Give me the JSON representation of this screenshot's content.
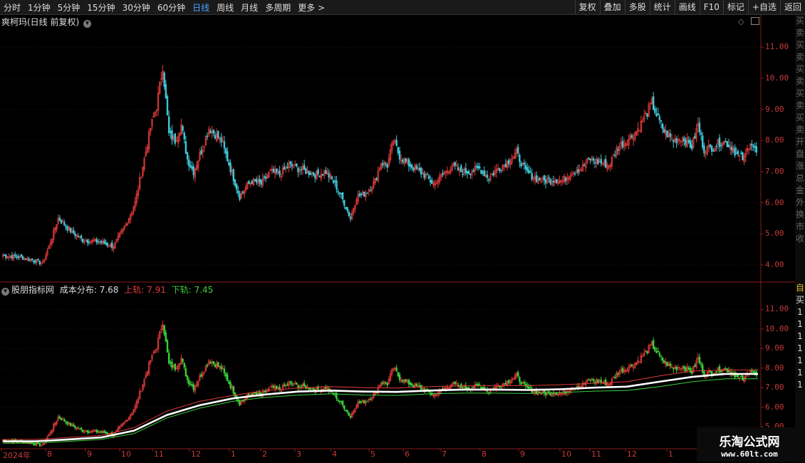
{
  "toolbar": {
    "periods": [
      "分时",
      "1分钟",
      "5分钟",
      "15分钟",
      "30分钟",
      "60分钟",
      "日线",
      "周线",
      "月线",
      "多周期",
      "更多 >"
    ],
    "active_period": "日线",
    "actions": [
      "复权",
      "叠加",
      "多股",
      "统计",
      "画线",
      "F10",
      "标记",
      "+自选",
      "返回"
    ]
  },
  "main_panel": {
    "title": "爽柯玛(日线 前复权)",
    "icons": [
      "chevron-down-icon",
      "diamond-icon",
      "panel-toggle-icon"
    ]
  },
  "indicator_panel": {
    "name": "股朋指标网",
    "cost_label": "成本分布:",
    "cost_value": "7.68",
    "upper_label": "上轨:",
    "upper_value": "7.91",
    "lower_label": "下轨:",
    "lower_value": "7.45",
    "colors": {
      "cost": "#ffffff",
      "upper": "#e03a3a",
      "lower": "#3ad13a"
    }
  },
  "main_axis_ticks": [
    "11.00",
    "10.00",
    "9.00",
    "8.00",
    "7.00",
    "6.00",
    "5.00",
    "4.00"
  ],
  "indicator_axis_ticks": [
    "11.00",
    "10.00",
    "9.00",
    "8.00",
    "7.00",
    "6.00",
    "5.00"
  ],
  "x_axis_labels": [
    "2024年",
    "8",
    "9",
    "10",
    "11",
    "12",
    "1",
    "2",
    "3",
    "4",
    "5",
    "6",
    "7",
    "8",
    "9",
    "10",
    "11",
    "12",
    "1"
  ],
  "sidebar_text": [
    "买",
    "卖",
    "买",
    "卖",
    "买",
    "卖",
    "买",
    "卖",
    "买",
    "卖",
    "开",
    "盘",
    "涨",
    "总",
    "金",
    "外",
    "换",
    "市",
    "收"
  ],
  "indicator_sidebar_text": [
    "自",
    "买",
    "1",
    "1",
    "1",
    "1",
    "1",
    "1",
    "1"
  ],
  "watermark": {
    "line1": "乐淘公式网",
    "line2": "www.60lt.com"
  },
  "chart_data": {
    "type": "candlestick",
    "title": "爽柯玛(日线 前复权)",
    "ylim": [
      3.7,
      11.6
    ],
    "up_color": "#e03a3a",
    "down_color": "#40c8d8",
    "keypoints": [
      [
        0,
        4.3
      ],
      [
        12,
        4.25
      ],
      [
        20,
        4.15
      ],
      [
        26,
        4.05
      ],
      [
        30,
        4.6
      ],
      [
        36,
        5.5
      ],
      [
        44,
        5.1
      ],
      [
        52,
        4.8
      ],
      [
        62,
        4.75
      ],
      [
        72,
        4.6
      ],
      [
        80,
        5.3
      ],
      [
        86,
        6.0
      ],
      [
        92,
        7.4
      ],
      [
        96,
        8.4
      ],
      [
        100,
        9.1
      ],
      [
        104,
        10.4
      ],
      [
        108,
        8.2
      ],
      [
        112,
        8.0
      ],
      [
        116,
        8.5
      ],
      [
        120,
        7.4
      ],
      [
        124,
        7.0
      ],
      [
        130,
        7.8
      ],
      [
        134,
        8.4
      ],
      [
        138,
        8.2
      ],
      [
        142,
        8.0
      ],
      [
        146,
        7.4
      ],
      [
        150,
        6.8
      ],
      [
        154,
        6.2
      ],
      [
        158,
        6.5
      ],
      [
        162,
        6.7
      ],
      [
        168,
        6.6
      ],
      [
        174,
        7.0
      ],
      [
        180,
        6.9
      ],
      [
        186,
        7.2
      ],
      [
        192,
        7.1
      ],
      [
        198,
        7.0
      ],
      [
        204,
        6.9
      ],
      [
        210,
        7.0
      ],
      [
        216,
        6.6
      ],
      [
        222,
        6.0
      ],
      [
        226,
        5.5
      ],
      [
        230,
        6.2
      ],
      [
        236,
        6.3
      ],
      [
        242,
        6.7
      ],
      [
        246,
        7.3
      ],
      [
        250,
        7.2
      ],
      [
        254,
        8.0
      ],
      [
        258,
        7.5
      ],
      [
        262,
        7.3
      ],
      [
        268,
        7.1
      ],
      [
        274,
        6.9
      ],
      [
        280,
        6.6
      ],
      [
        286,
        6.9
      ],
      [
        292,
        7.2
      ],
      [
        298,
        7.0
      ],
      [
        304,
        7.0
      ],
      [
        310,
        7.1
      ],
      [
        316,
        6.8
      ],
      [
        322,
        7.1
      ],
      [
        328,
        7.3
      ],
      [
        334,
        7.6
      ],
      [
        340,
        7.0
      ],
      [
        346,
        6.8
      ],
      [
        352,
        6.7
      ],
      [
        358,
        6.75
      ],
      [
        364,
        6.7
      ],
      [
        370,
        7.0
      ],
      [
        376,
        7.1
      ],
      [
        382,
        7.4
      ],
      [
        388,
        7.3
      ],
      [
        394,
        7.2
      ],
      [
        400,
        7.8
      ],
      [
        406,
        8.0
      ],
      [
        412,
        8.3
      ],
      [
        418,
        8.8
      ],
      [
        422,
        9.2
      ],
      [
        426,
        8.7
      ],
      [
        430,
        8.3
      ],
      [
        436,
        8.0
      ],
      [
        442,
        8.1
      ],
      [
        448,
        7.8
      ],
      [
        452,
        8.5
      ],
      [
        456,
        7.7
      ],
      [
        462,
        7.8
      ],
      [
        468,
        8.0
      ],
      [
        474,
        7.8
      ],
      [
        478,
        7.5
      ],
      [
        482,
        7.4
      ],
      [
        486,
        8.0
      ],
      [
        490,
        7.6
      ]
    ],
    "indicator": {
      "cost": [
        4.25,
        4.25,
        4.35,
        4.45,
        4.8,
        5.6,
        6.1,
        6.45,
        6.65,
        6.8,
        6.85,
        6.8,
        6.78,
        6.85,
        6.9,
        6.9,
        6.88,
        6.92,
        7.0,
        7.05,
        7.3,
        7.55,
        7.7,
        7.7
      ],
      "upper": [
        4.35,
        4.35,
        4.45,
        4.55,
        4.95,
        5.8,
        6.3,
        6.6,
        6.85,
        6.98,
        7.05,
        7.0,
        6.98,
        7.05,
        7.1,
        7.1,
        7.1,
        7.15,
        7.22,
        7.3,
        7.6,
        7.85,
        7.9,
        7.91
      ],
      "lower": [
        4.15,
        4.15,
        4.25,
        4.35,
        4.65,
        5.45,
        5.95,
        6.3,
        6.5,
        6.62,
        6.68,
        6.62,
        6.6,
        6.68,
        6.72,
        6.72,
        6.7,
        6.75,
        6.82,
        6.85,
        7.05,
        7.3,
        7.45,
        7.45
      ]
    }
  }
}
